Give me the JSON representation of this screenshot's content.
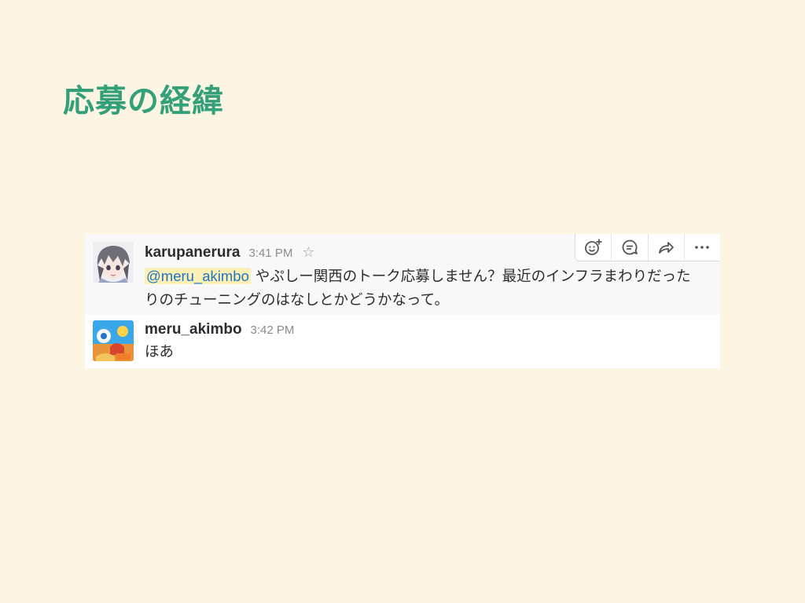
{
  "slide": {
    "title": "応募の経緯"
  },
  "messages": [
    {
      "user": "karupanerura",
      "time": "3:41 PM",
      "mention": "@meru_akimbo",
      "text": " やぷしー関西のトーク応募しません？最近のインフラまわりだったりのチューニングのはなしとかどうかなって。",
      "starred": false
    },
    {
      "user": "meru_akimbo",
      "time": "3:42 PM",
      "text": "ほあ"
    }
  ],
  "actions": [
    {
      "icon": "add-reaction-icon"
    },
    {
      "icon": "reply-thread-icon"
    },
    {
      "icon": "share-message-icon"
    },
    {
      "icon": "more-actions-icon"
    }
  ],
  "colors": {
    "background": "#fdf5e3",
    "title": "#33a07a",
    "mention_bg": "#fcf0b6",
    "mention_text": "#1d75c4",
    "hover_row": "#f8f8f8"
  }
}
